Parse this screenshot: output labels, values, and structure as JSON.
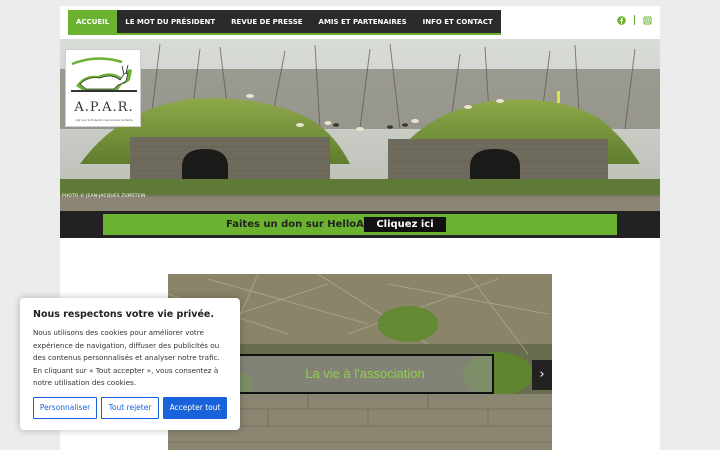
{
  "nav": {
    "items": [
      {
        "label": "ACCUEIL",
        "active": true
      },
      {
        "label": "LE MOT DU PRÉSIDENT"
      },
      {
        "label": "REVUE DE PRESSE"
      },
      {
        "label": "AMIS ET PARTENAIRES"
      },
      {
        "label": "INFO ET CONTACT"
      }
    ],
    "social": [
      "facebook-icon",
      "instagram-icon"
    ]
  },
  "hero": {
    "logo_text": "A.P.A.R.",
    "logo_subtitle": "Agir pour la Protection des Animaux de Rente",
    "photo_credit": "PHOTO © JEAN-JACQUES ZUMSTEIN"
  },
  "donation": {
    "text": "Faites un don sur HelloAsso",
    "button": "Cliquez ici"
  },
  "slider": {
    "caption": "La vie à l'association",
    "next_symbol": "›"
  },
  "cookie": {
    "title": "Nous respectons votre vie privée.",
    "body": "Nous utilisons des cookies pour améliorer votre expérience de navigation, diffuser des publicités ou des contenus personnalisés et analyser notre trafic. En cliquant sur « Tout accepter », vous consentez à notre utilisation des cookies.",
    "customize": "Personnaliser",
    "reject": "Tout rejeter",
    "accept": "Accepter tout"
  },
  "colors": {
    "accent": "#6ab22f",
    "nav_bg": "#2b2b2b",
    "cookie_blue": "#1863dc"
  }
}
